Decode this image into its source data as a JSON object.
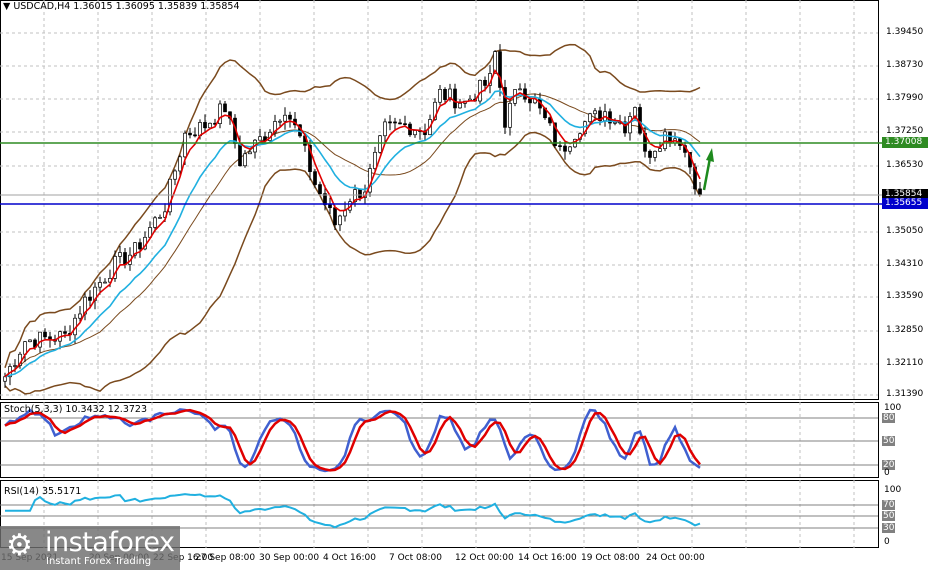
{
  "header": {
    "symbol_menu_icon": "triangle-down-icon",
    "title": "USDCAD,H4  1.36015 1.36095 1.35839 1.35854"
  },
  "price_axis": {
    "labels": [
      "1.39450",
      "1.38730",
      "1.37990",
      "1.37250",
      "1.36530",
      "1.35050",
      "1.34310",
      "1.33590",
      "1.32850",
      "1.32110",
      "1.31390"
    ],
    "current_price": "1.35854",
    "resistance_level": "1.37008",
    "support_level": "1.35655"
  },
  "colors": {
    "resistance": "#2e8b22",
    "support": "#0000cc",
    "bollinger": "#7a4a1e",
    "ma_fast": "#e00000",
    "ma_slow": "#20b0e0",
    "stoch_main": "#4060d0",
    "stoch_signal": "#e00000",
    "rsi": "#20b0e0",
    "arrow": "#1e8a1e"
  },
  "stochastic": {
    "label": "Stoch(5,3,3) 10.3432 12.3723",
    "levels": [
      "100",
      "80",
      "50",
      "20",
      "0"
    ]
  },
  "rsi": {
    "label": "RSI(14) 35.5171",
    "levels": [
      "100",
      "70",
      "50",
      "30",
      "0"
    ]
  },
  "time_axis": [
    "15 Sep 2021",
    "20 Sep 00:00",
    "22 Sep 16:00",
    "27 Sep 08:00",
    "30 Sep 00:00",
    "4 Oct 16:00",
    "7 Oct 08:00",
    "12 Oct 00:00",
    "14 Oct 16:00",
    "19 Oct 08:00",
    "24 Oct 00:00"
  ],
  "watermark": {
    "brand": "instaforex",
    "tagline": "Instant Forex Trading"
  },
  "chart_data": {
    "type": "candlestick",
    "symbol": "USDCAD",
    "timeframe": "H4",
    "ylim": [
      1.3125,
      1.4
    ],
    "close_keypoints": [
      [
        0,
        1.318
      ],
      [
        4,
        1.326
      ],
      [
        12,
        1.327
      ],
      [
        16,
        1.335
      ],
      [
        22,
        1.343
      ],
      [
        26,
        1.346
      ],
      [
        32,
        1.356
      ],
      [
        36,
        1.372
      ],
      [
        40,
        1.374
      ],
      [
        44,
        1.378
      ],
      [
        47,
        1.366
      ],
      [
        52,
        1.372
      ],
      [
        56,
        1.378
      ],
      [
        59,
        1.371
      ],
      [
        62,
        1.361
      ],
      [
        66,
        1.352
      ],
      [
        69,
        1.358
      ],
      [
        72,
        1.36
      ],
      [
        76,
        1.373
      ],
      [
        80,
        1.374
      ],
      [
        84,
        1.373
      ],
      [
        87,
        1.381
      ],
      [
        92,
        1.379
      ],
      [
        97,
        1.384
      ],
      [
        98,
        1.39
      ],
      [
        100,
        1.375
      ],
      [
        103,
        1.383
      ],
      [
        106,
        1.379
      ],
      [
        109,
        1.373
      ],
      [
        111,
        1.368
      ],
      [
        115,
        1.374
      ],
      [
        120,
        1.377
      ],
      [
        124,
        1.374
      ],
      [
        126,
        1.379
      ],
      [
        128,
        1.367
      ],
      [
        132,
        1.372
      ],
      [
        135,
        1.371
      ],
      [
        137,
        1.365
      ],
      [
        139,
        1.3585
      ]
    ],
    "horizontal_lines": [
      {
        "name": "resistance",
        "value": 1.37008
      },
      {
        "name": "support",
        "value": 1.35655
      }
    ],
    "annotation": "green up arrow"
  }
}
